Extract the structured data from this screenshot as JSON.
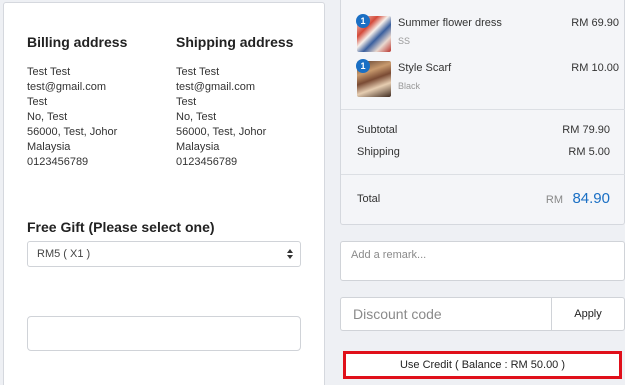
{
  "billing": {
    "title": "Billing address",
    "lines": [
      "Test Test",
      "test@gmail.com",
      "Test",
      "No, Test",
      "56000, Test, Johor",
      "Malaysia",
      "0123456789"
    ]
  },
  "shipping": {
    "title": "Shipping address",
    "lines": [
      "Test Test",
      "test@gmail.com",
      "Test",
      "No, Test",
      "56000, Test, Johor",
      "Malaysia",
      "0123456789"
    ]
  },
  "free_gift": {
    "title": "Free Gift (Please select one)",
    "selected": "RM5 ( X1 )"
  },
  "cart": {
    "items": [
      {
        "qty": "1",
        "name": "Summer flower dress",
        "variant": "SS",
        "price": "RM 69.90"
      },
      {
        "qty": "1",
        "name": "Style Scarf",
        "variant": "Black",
        "price": "RM 10.00"
      }
    ],
    "subtotal_label": "Subtotal",
    "subtotal_value": "RM 79.90",
    "shipping_label": "Shipping",
    "shipping_value": "RM 5.00",
    "total_label": "Total",
    "total_currency": "RM",
    "total_amount": "84.90"
  },
  "remark": {
    "placeholder": "Add a remark..."
  },
  "discount": {
    "placeholder": "Discount code",
    "apply_label": "Apply"
  },
  "credit": {
    "label": "Use Credit ( Balance : RM 50.00 )"
  },
  "colors": {
    "accent": "#1a6fc4",
    "highlight": "#e00f1a"
  }
}
